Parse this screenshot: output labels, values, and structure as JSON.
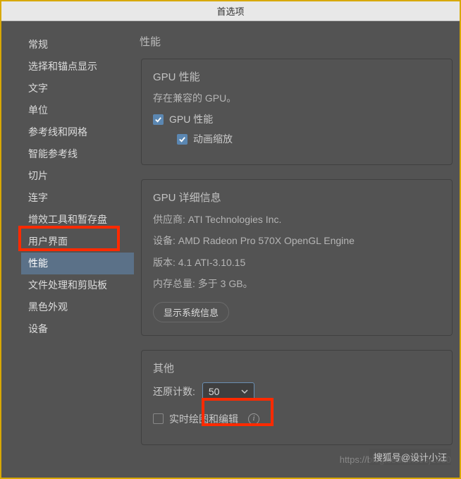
{
  "window": {
    "title": "首选项"
  },
  "sidebar": {
    "items": [
      {
        "label": "常规"
      },
      {
        "label": "选择和锚点显示"
      },
      {
        "label": "文字"
      },
      {
        "label": "单位"
      },
      {
        "label": "参考线和网格"
      },
      {
        "label": "智能参考线"
      },
      {
        "label": "切片"
      },
      {
        "label": "连字"
      },
      {
        "label": "增效工具和暂存盘"
      },
      {
        "label": "用户界面"
      },
      {
        "label": "性能",
        "selected": true
      },
      {
        "label": "文件处理和剪贴板"
      },
      {
        "label": "黑色外观"
      },
      {
        "label": "设备"
      }
    ]
  },
  "main": {
    "title": "性能",
    "gpu_panel": {
      "title": "GPU 性能",
      "subtitle": "存在兼容的 GPU。",
      "gpu_perf_label": "GPU 性能",
      "animated_zoom_label": "动画缩放"
    },
    "details_panel": {
      "title": "GPU 详细信息",
      "vendor_label": "供应商:",
      "vendor_val": "ATI Technologies Inc.",
      "device_label": "设备:",
      "device_val": "AMD Radeon Pro 570X OpenGL Engine",
      "version_label": "版本:",
      "version_val": "4.1 ATI-3.10.15",
      "memory_label": "内存总量:",
      "memory_val": "多于 3 GB。",
      "sysinfo_btn": "显示系统信息"
    },
    "other_panel": {
      "title": "其他",
      "undo_label": "还原计数:",
      "undo_value": "50",
      "realtime_label": "实时绘图和编辑"
    }
  },
  "watermarks": {
    "a": "https://blog.csdn.net/sj1000",
    "b": "搜狐号@设计小汪"
  }
}
